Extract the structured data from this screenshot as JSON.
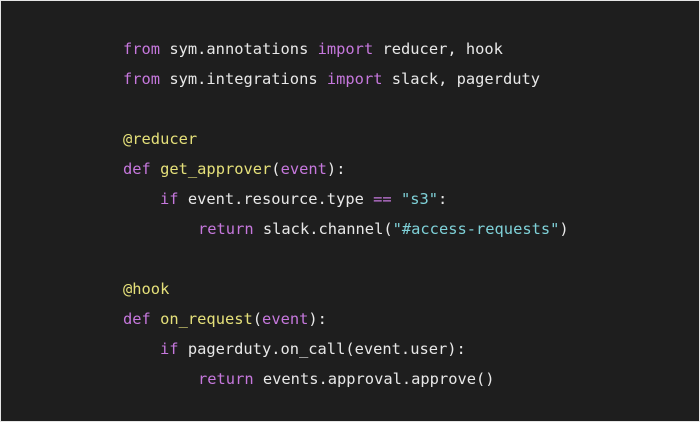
{
  "colors": {
    "background": "#1e1e1e",
    "keyword": "#c678dd",
    "decorator": "#e5e07a",
    "function": "#e5e07a",
    "string": "#7fd1d8",
    "text": "#e8e8e8"
  },
  "code": {
    "line1": {
      "kw1": "from",
      "mod": " sym.annotations ",
      "kw2": "import",
      "names": " reducer, hook"
    },
    "line2": {
      "kw1": "from",
      "mod": " sym.integrations ",
      "kw2": "import",
      "names": " slack, pagerduty"
    },
    "line4": {
      "decorator": "@reducer"
    },
    "line5": {
      "kw": "def",
      "fn": "get_approver",
      "open": "(",
      "param": "event",
      "close": "):"
    },
    "line6": {
      "kw": "if",
      "expr": " event.resource.type ",
      "op": "==",
      "sp": " ",
      "str": "\"s3\"",
      "end": ":"
    },
    "line7": {
      "kw": "return",
      "expr": " slack.channel(",
      "str": "\"#access-requests\"",
      "end": ")"
    },
    "line9": {
      "decorator": "@hook"
    },
    "line10": {
      "kw": "def",
      "fn": "on_request",
      "open": "(",
      "param": "event",
      "close": "):"
    },
    "line11": {
      "kw": "if",
      "expr": " pagerduty.on_call(event.user):"
    },
    "line12": {
      "kw": "return",
      "expr": " events.approval.approve()"
    }
  }
}
